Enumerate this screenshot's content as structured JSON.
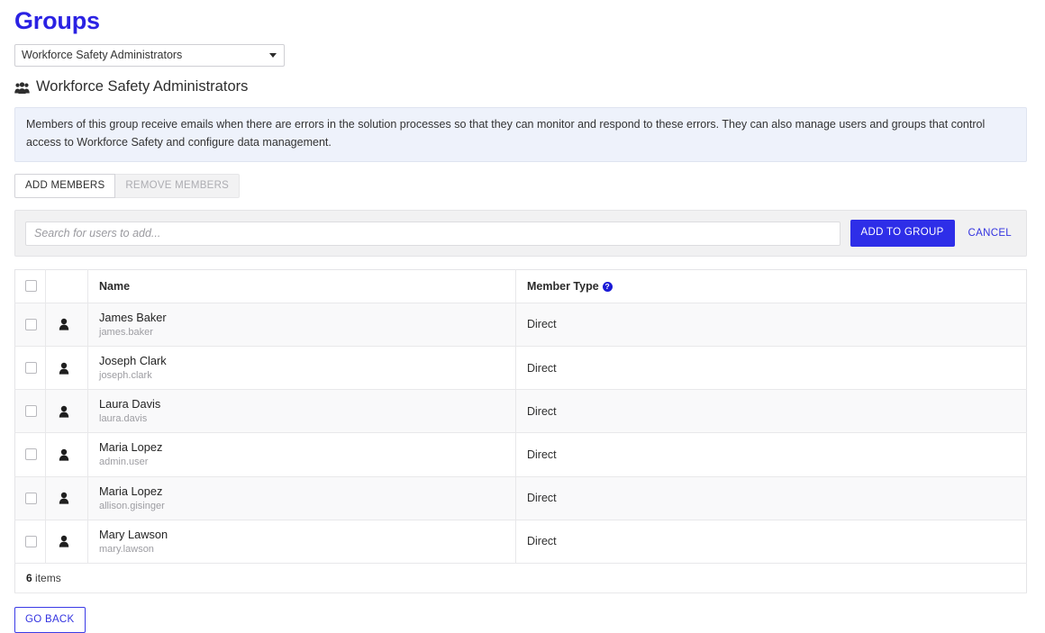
{
  "page": {
    "title": "Groups"
  },
  "group_selector": {
    "selected": "Workforce Safety Administrators",
    "caret_icon": "chevron-down-icon",
    "options": [
      "Workforce Safety Administrators"
    ]
  },
  "group_heading": {
    "icon": "users-group-icon",
    "name": "Workforce Safety Administrators"
  },
  "description": {
    "text": "Members of this group receive emails when there are errors in the solution processes so that they can monitor and respond to these errors. They can also manage users and groups that control access to Workforce Safety and configure data management."
  },
  "member_buttons": {
    "add_label": "ADD MEMBERS",
    "remove_label": "REMOVE MEMBERS"
  },
  "search_panel": {
    "placeholder": "Search for users to add...",
    "value": "",
    "add_to_group_label": "ADD TO GROUP",
    "cancel_label": "CANCEL"
  },
  "table": {
    "headers": {
      "name": "Name",
      "member_type": "Member Type",
      "help_icon": "help-circle-icon"
    },
    "rows": [
      {
        "icon": "person-icon",
        "name": "James Baker",
        "username": "james.baker",
        "member_type": "Direct"
      },
      {
        "icon": "person-icon",
        "name": "Joseph Clark",
        "username": "joseph.clark",
        "member_type": "Direct"
      },
      {
        "icon": "person-icon",
        "name": "Laura Davis",
        "username": "laura.davis",
        "member_type": "Direct"
      },
      {
        "icon": "person-icon",
        "name": "Maria Lopez",
        "username": "admin.user",
        "member_type": "Direct"
      },
      {
        "icon": "person-icon",
        "name": "Maria Lopez",
        "username": "allison.gisinger",
        "member_type": "Direct"
      },
      {
        "icon": "person-icon",
        "name": "Mary Lawson",
        "username": "mary.lawson",
        "member_type": "Direct"
      }
    ],
    "footer": {
      "count": "6",
      "count_label": "items"
    }
  },
  "footer": {
    "go_back_label": "GO BACK"
  },
  "colors": {
    "title_blue": "#2b22e3",
    "primary_button": "#2e2ee8",
    "link_blue": "#3434e0",
    "info_box_bg": "#eef2fb",
    "help_icon_blue": "#1a1ad6",
    "row_stripe": "#f9f9fa"
  }
}
